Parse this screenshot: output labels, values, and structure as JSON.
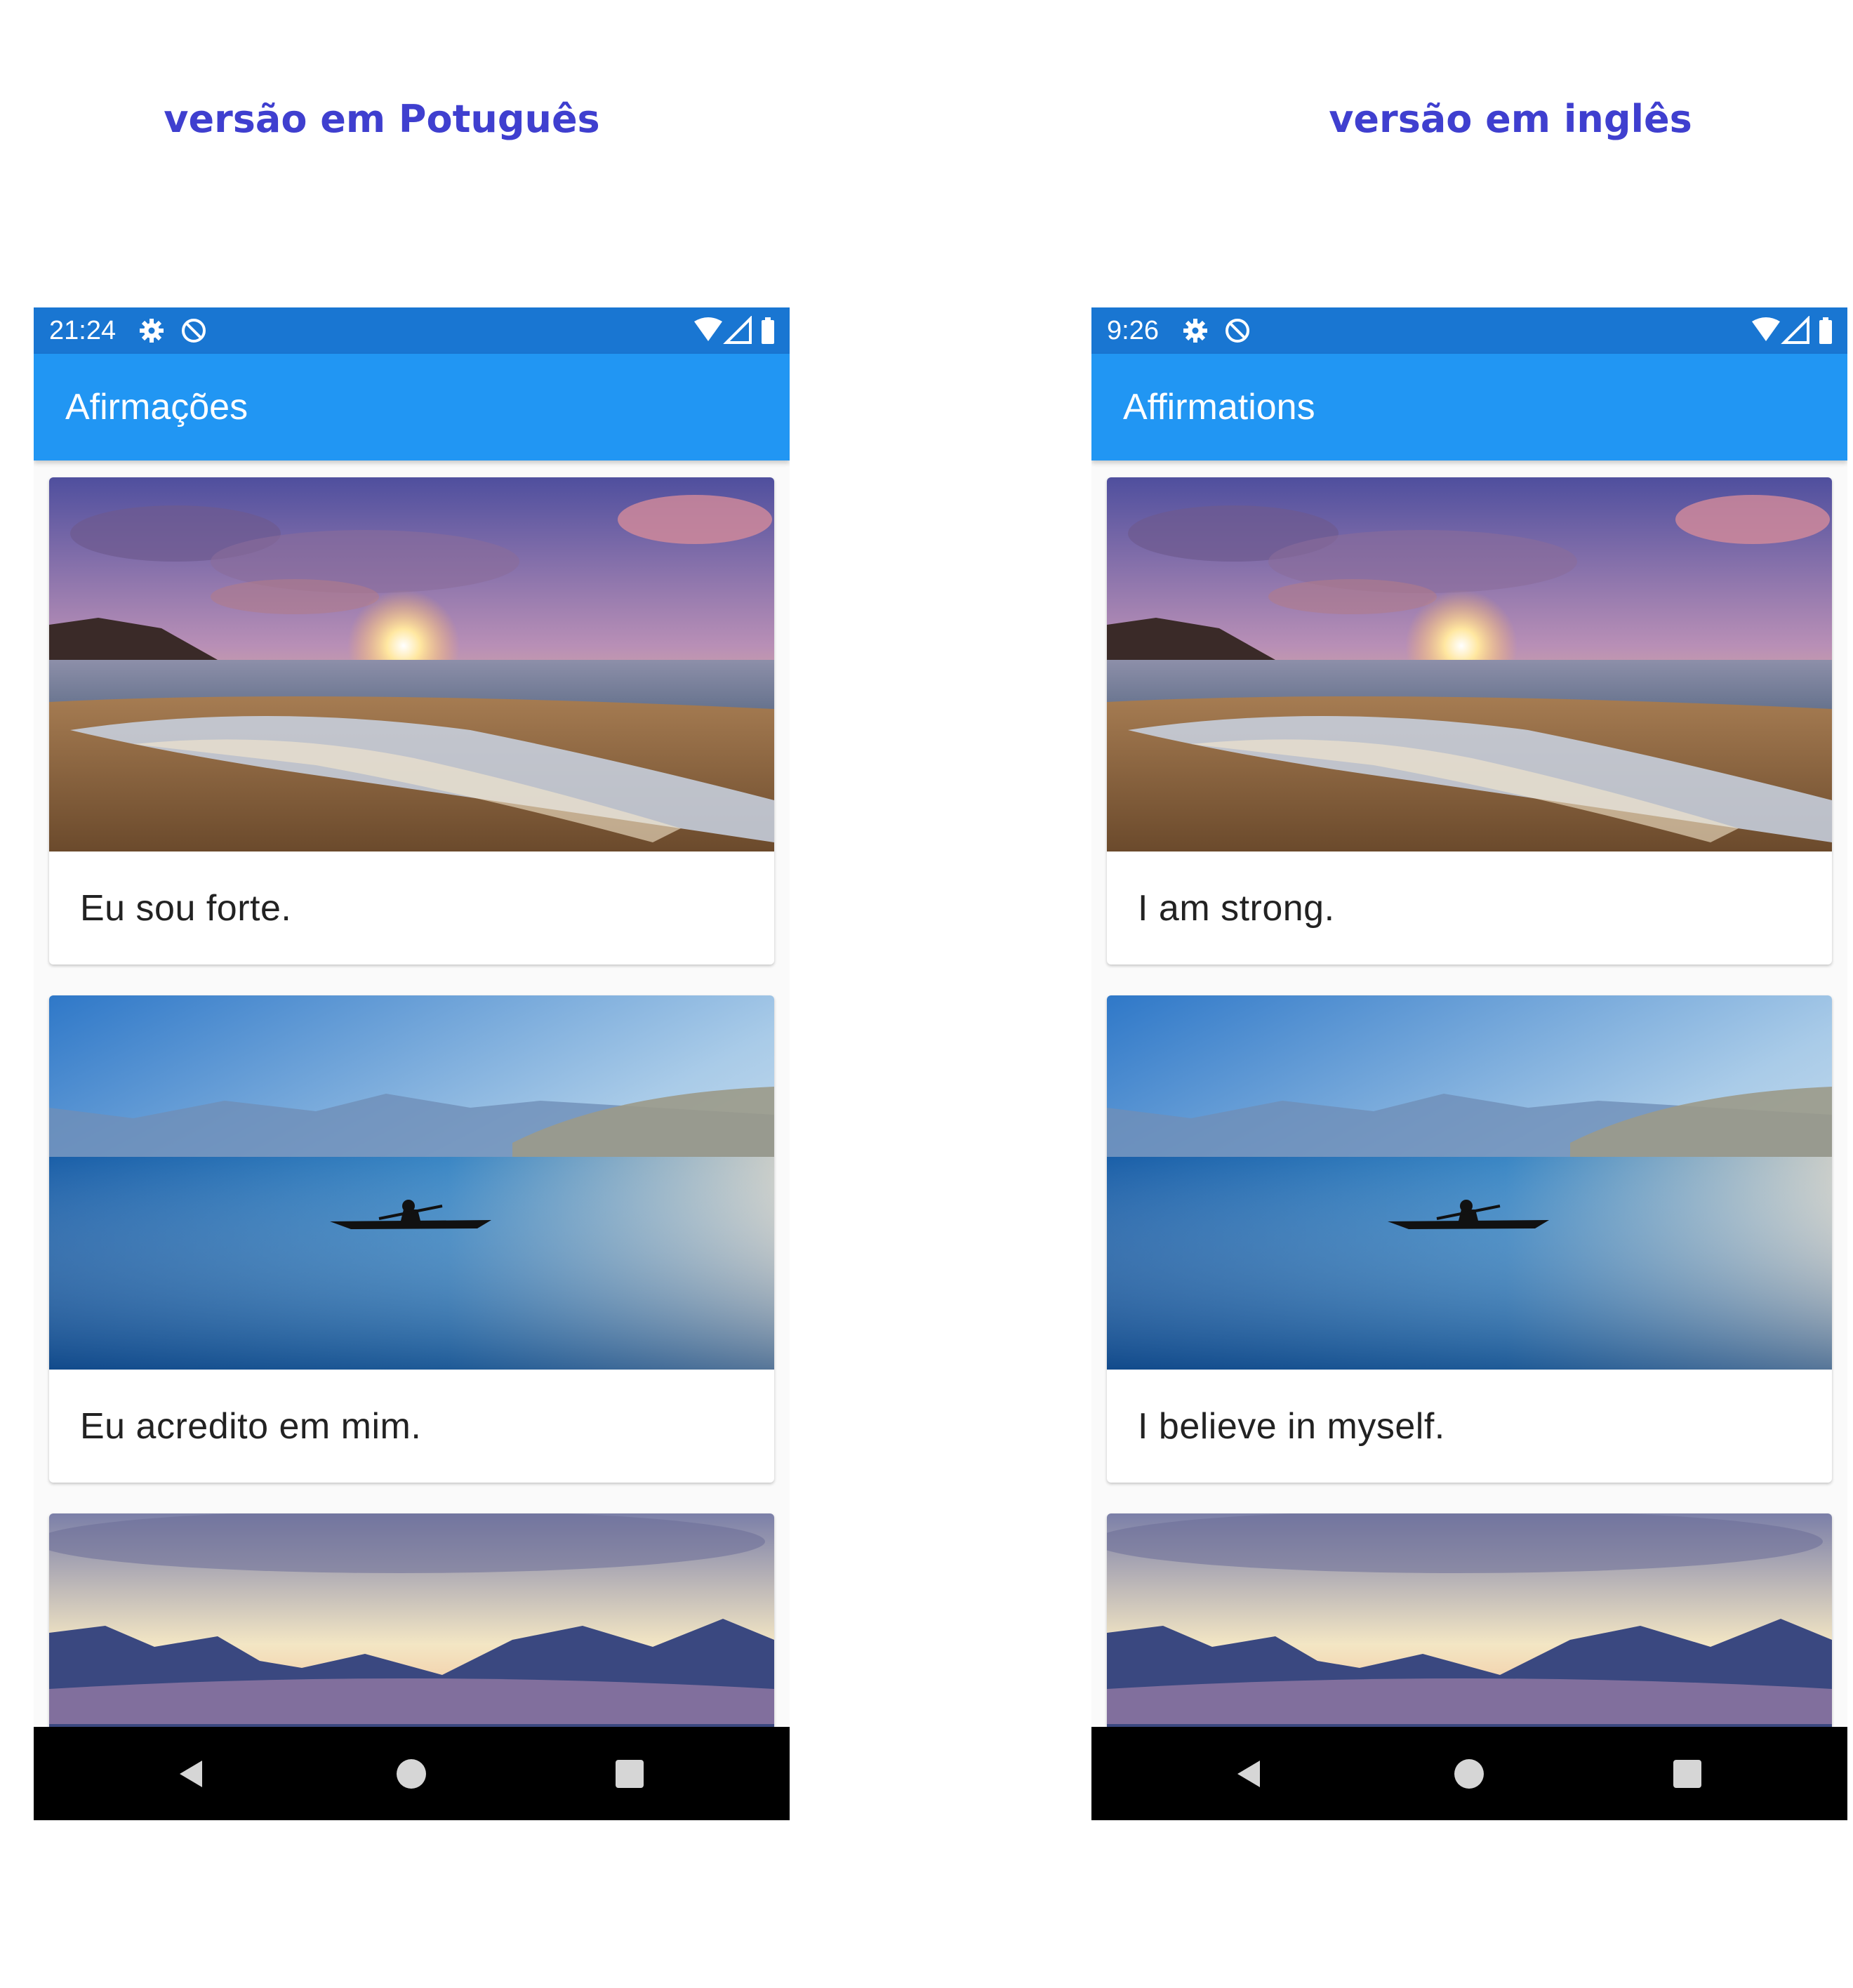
{
  "captions": {
    "left": "versão em Potuguês",
    "right": "versão em inglês"
  },
  "phones": [
    {
      "status_time": "21:24",
      "app_title": "Afirmações",
      "cards": [
        {
          "text": "Eu sou forte.",
          "image": "beach-sunset"
        },
        {
          "text": "Eu acredito em mim.",
          "image": "lake-kayak"
        },
        {
          "image": "mountain-sunset"
        }
      ]
    },
    {
      "status_time": "9:26",
      "app_title": "Affirmations",
      "cards": [
        {
          "text": "I am strong.",
          "image": "beach-sunset"
        },
        {
          "text": "I believe in myself.",
          "image": "lake-kayak"
        },
        {
          "image": "mountain-sunset"
        }
      ]
    }
  ],
  "status_icons": [
    "settings-icon",
    "data-saver-icon",
    "wifi-icon",
    "signal-icon",
    "battery-icon"
  ],
  "nav_icons": [
    "back-icon",
    "home-icon",
    "recents-icon"
  ],
  "colors": {
    "caption": "#3f3fcf",
    "status_bar": "#1976d2",
    "app_bar": "#2196f3",
    "nav_bar": "#000000"
  }
}
